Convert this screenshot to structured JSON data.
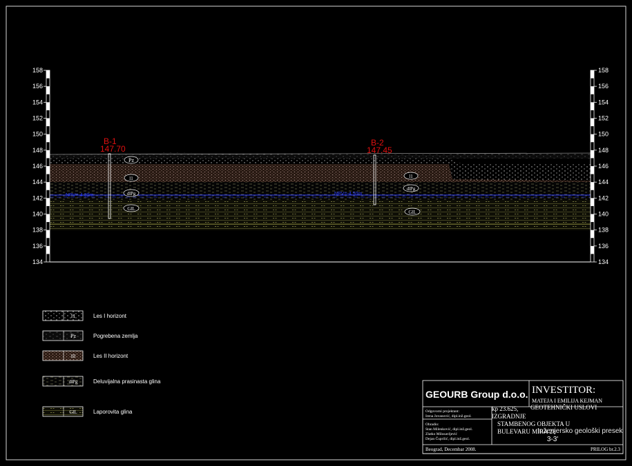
{
  "profile": {
    "scale_ticks": [
      "158",
      "156",
      "154",
      "152",
      "150",
      "148",
      "146",
      "144",
      "142",
      "140",
      "138",
      "136",
      "134"
    ],
    "boreholes": [
      {
        "name": "B-1",
        "elevation": "147.70"
      },
      {
        "name": "B-2",
        "elevation": "147.45"
      }
    ],
    "water_table": [
      "NPV=-4.30m",
      "NPV=-4.50m"
    ],
    "layer_tags": {
      "pz": "Pz",
      "l1": "l1",
      "dl": "dlPg",
      "gl": "GlL"
    }
  },
  "legend": [
    {
      "code": "l1",
      "label": "Les I horizont"
    },
    {
      "code": "Pz",
      "label": "Pogrebena zemlja"
    },
    {
      "code": "lII",
      "label": "Les II horizont"
    },
    {
      "code": "dlPg",
      "label": "Deluvijalna prasinasta glina"
    },
    {
      "code": "GlL",
      "label": "Laporovita glina"
    }
  ],
  "title_block": {
    "company": "GEOURB Group d.o.o.",
    "investor_title": "INVESTITOR:",
    "investor_name": "MATEJA I EMILIJA KEJMAN",
    "project_lines": [
      "GEOTEHNIČKI USLOVI",
      "IZGRADNJE",
      "STAMBENOG OBJEKTA U",
      "BULEVARU MIRA 28"
    ],
    "parcel": "kp 23.625,",
    "responsible_label": "Odgovorni projektant:",
    "responsible_name": "Irena Jovanović, dipl.inž.geol.",
    "processed_label": "Obradio:",
    "processed_1": "Stan Milenković, dipl.inž.geol.",
    "processed_2": "Zlatko Milosavljević",
    "processed_3": "Dejan Čuprilić, dipl.inž.geol.",
    "drawing_title": "Inženjersko geološki presek",
    "section": "3-3'",
    "place_date": "Beograd, Decembar 2008.",
    "sheet": "PRILOG br.2.3"
  }
}
